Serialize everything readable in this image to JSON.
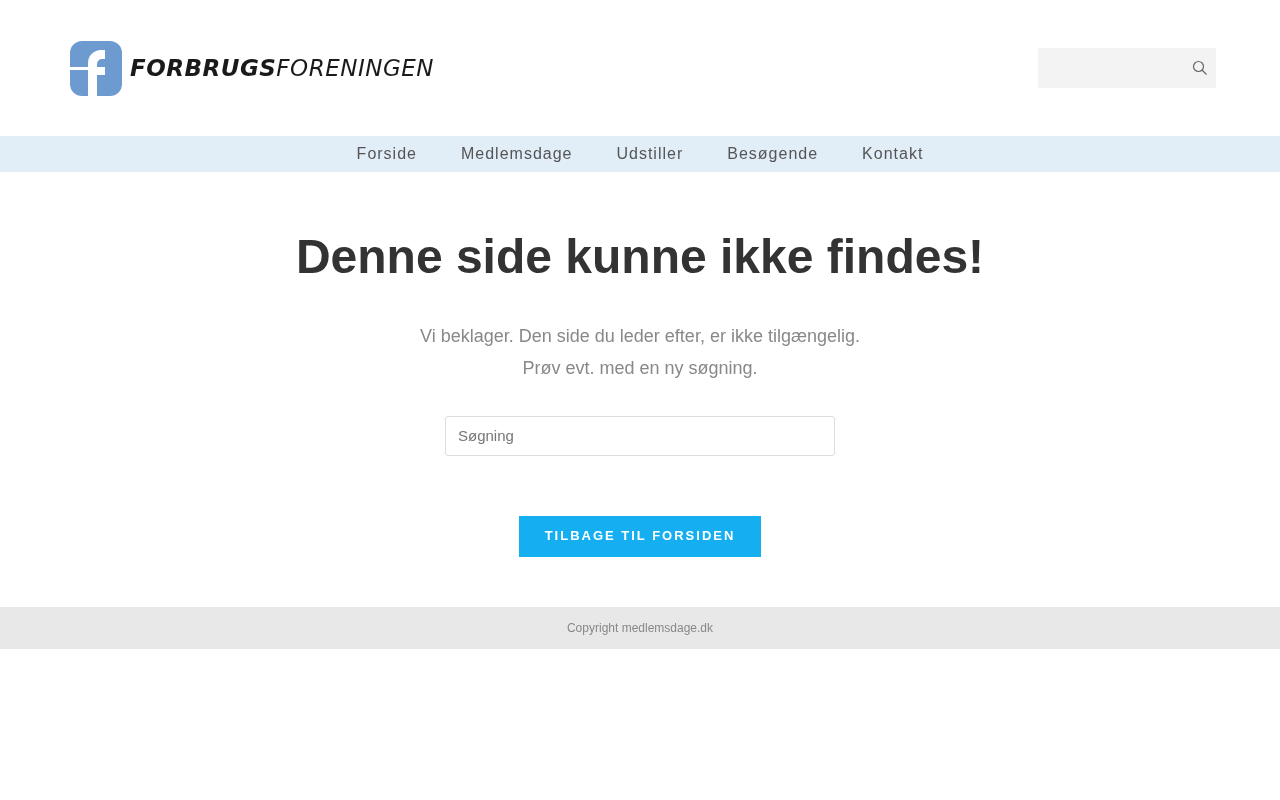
{
  "logo": {
    "text": "**FORBRUGS**FORENINGEN"
  },
  "nav": [
    {
      "label": "Forside"
    },
    {
      "label": "Medlemsdage"
    },
    {
      "label": "Udstiller"
    },
    {
      "label": "Besøgende"
    },
    {
      "label": "Kontakt"
    }
  ],
  "title": "Denne side kunne ikke findes!",
  "message": [
    "Vi beklager. Den side du leder efter, er ikke tilgængelig.",
    "Prøv evt. med en ny søgning."
  ],
  "search": {
    "placeholder": "Søgning"
  },
  "button": "TILBAGE TIL FORSIDEN",
  "footer": "Copyright medlemsdage.dk"
}
